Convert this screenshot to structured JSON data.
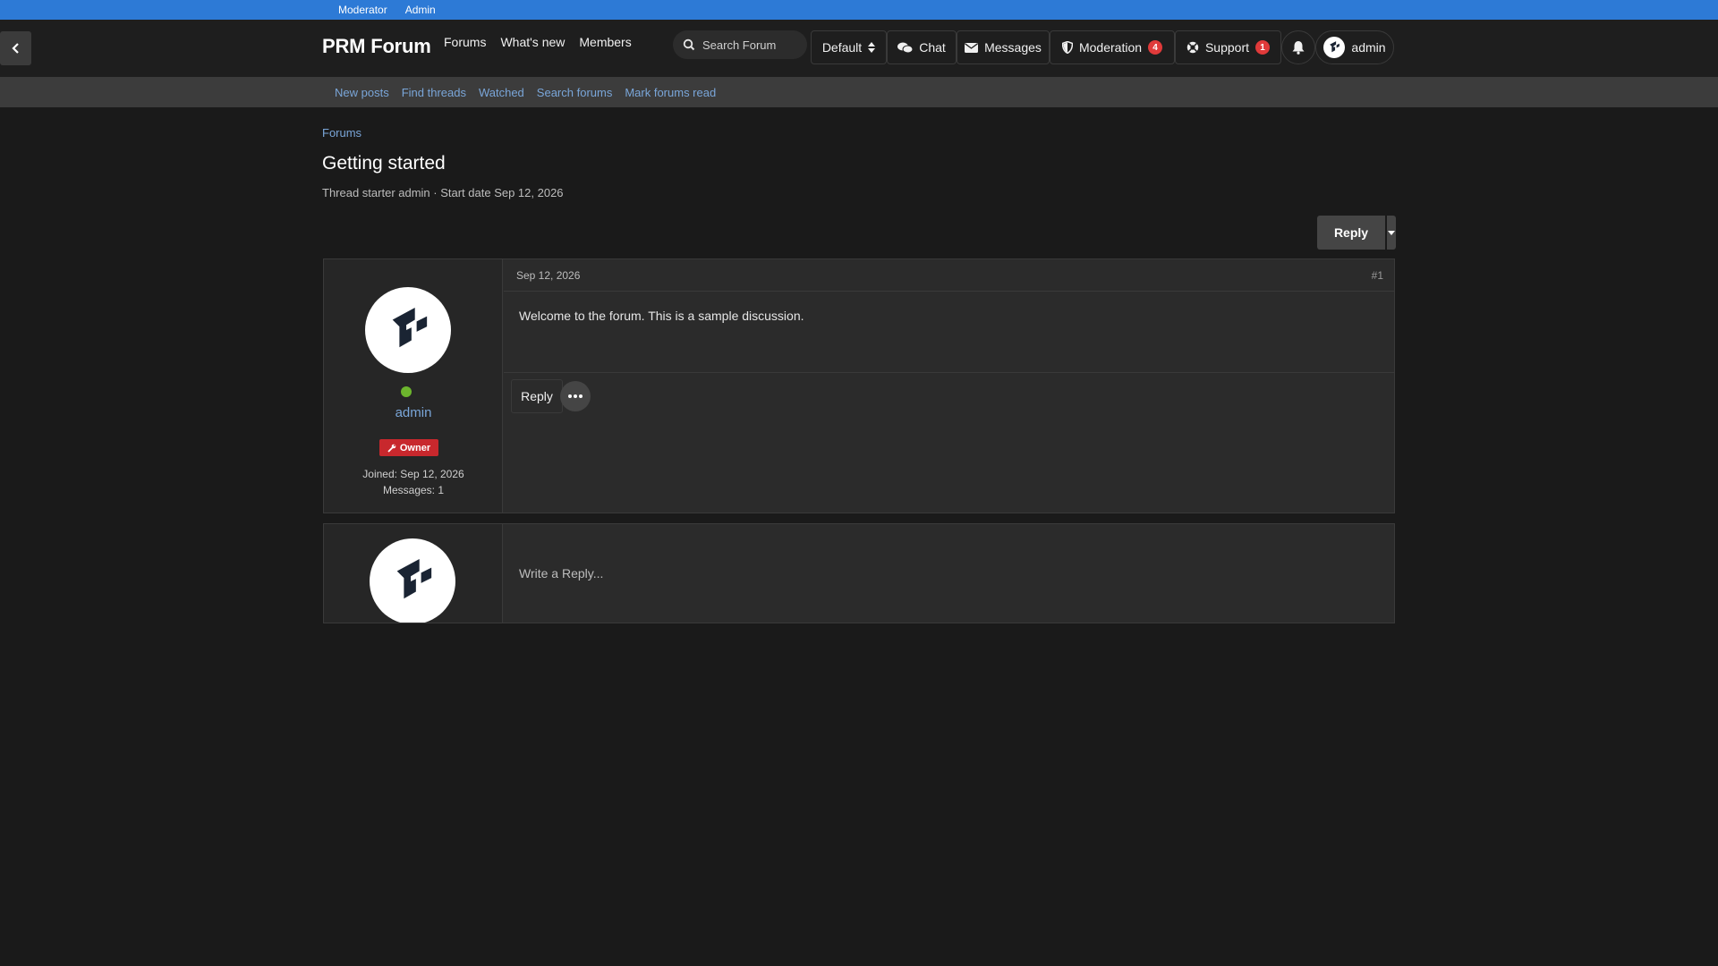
{
  "staff_bar": {
    "items": [
      "Moderator",
      "Admin"
    ]
  },
  "header": {
    "logo": "PRM Forum",
    "nav": [
      "Forums",
      "What's new",
      "Members"
    ],
    "search_placeholder": "Search Forum",
    "style_selector": "Default",
    "chat": "Chat",
    "messages": "Messages",
    "moderation": "Moderation",
    "moderation_count": "4",
    "support": "Support",
    "support_count": "1",
    "account": "admin"
  },
  "subnav": [
    "New posts",
    "Find threads",
    "Watched",
    "Search forums",
    "Mark forums read"
  ],
  "breadcrumb": "Forums",
  "thread": {
    "title": "Getting started",
    "meta": "Thread starter admin · Start date Sep 12, 2026",
    "reply_label": "Reply"
  },
  "post": {
    "date": "Sep 12, 2026",
    "number": "#1",
    "body": "Welcome to the forum. This is a sample discussion.",
    "author": "admin",
    "badge": "Owner",
    "joined": "Joined: Sep 12, 2026",
    "messages": "Messages: 1",
    "reply_label": "Reply"
  },
  "reply_box": {
    "placeholder": "Write a Reply..."
  },
  "colors": {
    "staff_bar": "#2d7ad6",
    "link": "#7aa6d9",
    "badge_red": "#e03a3a",
    "owner_red": "#c8282d",
    "online": "#6cb52d"
  }
}
